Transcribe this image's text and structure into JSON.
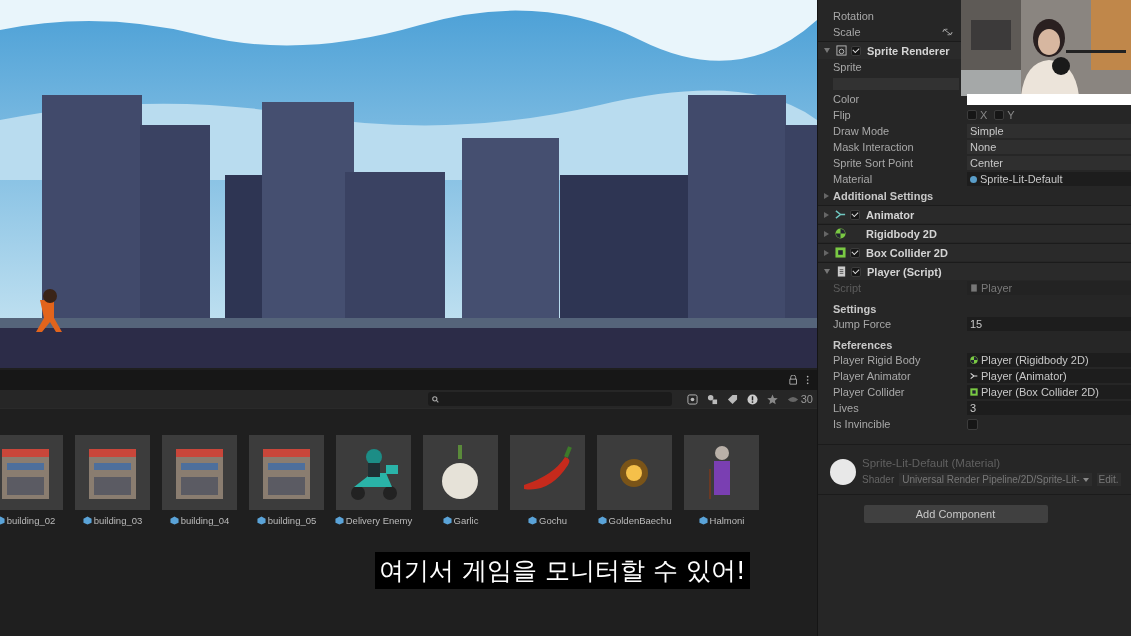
{
  "project_browser": {
    "visible_count": "30"
  },
  "assets": [
    {
      "name": "building_02",
      "kind": "building"
    },
    {
      "name": "building_03",
      "kind": "building"
    },
    {
      "name": "building_04",
      "kind": "building"
    },
    {
      "name": "building_05",
      "kind": "building"
    },
    {
      "name": "Delivery Enemy",
      "kind": "scooter"
    },
    {
      "name": "Garlic",
      "kind": "garlic"
    },
    {
      "name": "Gochu",
      "kind": "pepper"
    },
    {
      "name": "GoldenBaechu",
      "kind": "glow"
    },
    {
      "name": "Halmoni",
      "kind": "figure"
    }
  ],
  "subtitle": "여기서 게임을 모니터할 수 있어!",
  "inspector": {
    "transform_rows": [
      {
        "label": "Rotation",
        "linked": false
      },
      {
        "label": "Scale",
        "linked": true
      }
    ],
    "sprite_renderer": {
      "title": "Sprite Renderer",
      "expanded": true,
      "enabled": true,
      "sprite_label": "Sprite",
      "fields": [
        {
          "label": "Color",
          "kind": "color",
          "color": "#ffffff"
        },
        {
          "label": "Flip",
          "kind": "flip",
          "x": "X",
          "y": "Y",
          "x_checked": false,
          "y_checked": false
        },
        {
          "label": "Draw Mode",
          "kind": "dropdown",
          "value": "Simple"
        },
        {
          "label": "Mask Interaction",
          "kind": "dropdown",
          "value": "None"
        },
        {
          "label": "Sprite Sort Point",
          "kind": "dropdown",
          "value": "Center"
        },
        {
          "label": "Material",
          "kind": "material",
          "value": "Sprite-Lit-Default"
        }
      ],
      "additional": {
        "label": "Additional Settings",
        "expanded": false
      }
    },
    "components": [
      {
        "title": "Animator",
        "kind": "animator",
        "expanded": false,
        "enabled": true
      },
      {
        "title": "Rigidbody 2D",
        "kind": "rigidbody",
        "expanded": false
      },
      {
        "title": "Box Collider 2D",
        "kind": "collider",
        "expanded": false,
        "enabled": true
      }
    ],
    "player_script": {
      "title": "Player (Script)",
      "expanded": true,
      "enabled": true,
      "rows": [
        {
          "kind": "script",
          "label": "Script",
          "value": "Player"
        },
        {
          "kind": "header",
          "label": "Settings"
        },
        {
          "kind": "text",
          "label": "Jump Force",
          "value": "15"
        },
        {
          "kind": "header",
          "label": "References"
        },
        {
          "kind": "rigidbody",
          "label": "Player Rigid Body",
          "value": "Player (Rigidbody 2D)"
        },
        {
          "kind": "animator",
          "label": "Player Animator",
          "value": "Player (Animator)"
        },
        {
          "kind": "collider",
          "label": "Player Collider",
          "value": "Player (Box Collider 2D)"
        },
        {
          "kind": "text",
          "label": "Lives",
          "value": "3"
        },
        {
          "kind": "checkbox",
          "label": "Is Invincible",
          "checked": false
        }
      ]
    },
    "material": {
      "title": "Sprite-Lit-Default (Material)",
      "shader_label": "Shader",
      "shader": "Universal Render Pipeline/2D/Sprite-Lit-",
      "edit": "Edit."
    },
    "add_component": "Add Component"
  }
}
